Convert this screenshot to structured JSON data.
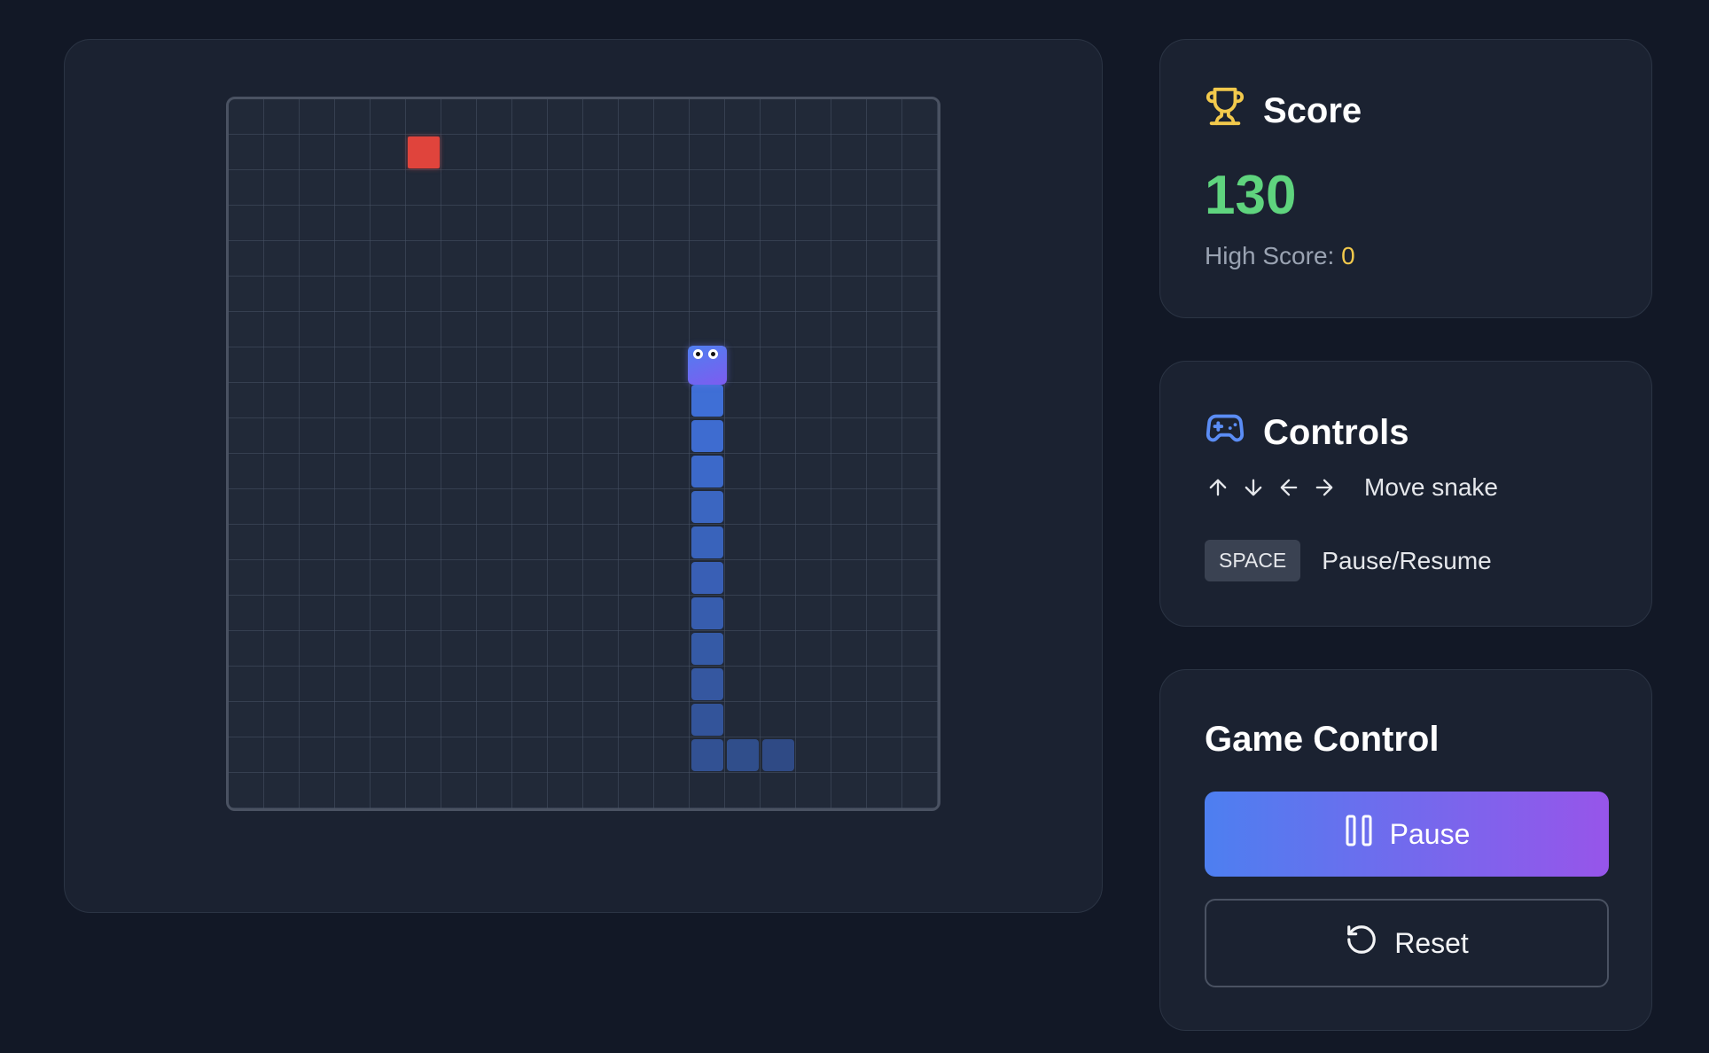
{
  "score_card": {
    "title": "Score",
    "icon": "trophy-icon",
    "score": "130",
    "high_score_label": "High Score:",
    "high_score_value": "0"
  },
  "controls_card": {
    "title": "Controls",
    "icon": "gamepad-icon",
    "arrow_keys": [
      "↑",
      "↓",
      "←",
      "→"
    ],
    "move_label": "Move snake",
    "space_key": "SPACE",
    "pause_label": "Pause/Resume"
  },
  "game_control": {
    "title": "Game Control",
    "pause_button": "Pause",
    "reset_button": "Reset"
  },
  "board": {
    "grid_cells": 20,
    "food": {
      "col": 5,
      "row": 1
    },
    "snake_head": {
      "col": 13,
      "row": 7
    },
    "snake_body": [
      {
        "col": 13,
        "row": 8
      },
      {
        "col": 13,
        "row": 9
      },
      {
        "col": 13,
        "row": 10
      },
      {
        "col": 13,
        "row": 11
      },
      {
        "col": 13,
        "row": 12
      },
      {
        "col": 13,
        "row": 13
      },
      {
        "col": 13,
        "row": 14
      },
      {
        "col": 13,
        "row": 15
      },
      {
        "col": 13,
        "row": 16
      },
      {
        "col": 13,
        "row": 17
      },
      {
        "col": 13,
        "row": 18
      },
      {
        "col": 14,
        "row": 18
      },
      {
        "col": 15,
        "row": 18
      }
    ]
  },
  "colors": {
    "background": "#121826",
    "score_value": "#5fd47e",
    "high_score_value": "#f2c94c",
    "snake": "#3f6fd6",
    "food": "#e0443c",
    "pause_gradient_start": "#4d7ff0",
    "pause_gradient_end": "#9755ea"
  }
}
